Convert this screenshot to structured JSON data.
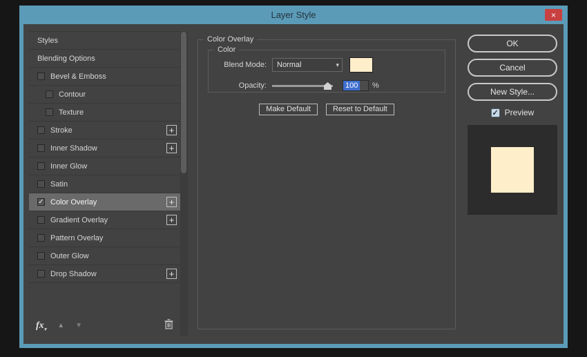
{
  "window": {
    "title": "Layer Style"
  },
  "icons": {
    "close": "×",
    "check": "✓",
    "dropdown": "▾",
    "arrow_up": "▲",
    "arrow_down": "▼",
    "plus": "+"
  },
  "styles_panel": {
    "items": [
      {
        "label": "Styles"
      },
      {
        "label": "Blending Options"
      },
      {
        "label": "Bevel & Emboss",
        "checkbox": true
      },
      {
        "label": "Contour",
        "checkbox": true,
        "indent": true
      },
      {
        "label": "Texture",
        "checkbox": true,
        "indent": true
      },
      {
        "label": "Stroke",
        "checkbox": true,
        "plus": true
      },
      {
        "label": "Inner Shadow",
        "checkbox": true,
        "plus": true
      },
      {
        "label": "Inner Glow",
        "checkbox": true
      },
      {
        "label": "Satin",
        "checkbox": true
      },
      {
        "label": "Color Overlay",
        "checkbox": true,
        "checked": true,
        "plus": true,
        "selected": true
      },
      {
        "label": "Gradient Overlay",
        "checkbox": true,
        "plus": true
      },
      {
        "label": "Pattern Overlay",
        "checkbox": true
      },
      {
        "label": "Outer Glow",
        "checkbox": true
      },
      {
        "label": "Drop Shadow",
        "checkbox": true,
        "plus": true
      }
    ],
    "footer": {
      "fx_label": "fx"
    }
  },
  "main": {
    "group_title": "Color Overlay",
    "color_group_title": "Color",
    "blend_mode_label": "Blend Mode:",
    "blend_mode_value": "Normal",
    "opacity_label": "Opacity:",
    "opacity_value": "100",
    "opacity_unit": "%",
    "make_default": "Make Default",
    "reset_to_default": "Reset to Default"
  },
  "actions": {
    "ok": "OK",
    "cancel": "Cancel",
    "new_style": "New Style...",
    "preview": "Preview"
  },
  "colors": {
    "titlebar_blue": "#5b9bb8",
    "close_red": "#c94040",
    "swatch_cream": "#ffeeca",
    "selection_blue": "#3f6fd0"
  }
}
